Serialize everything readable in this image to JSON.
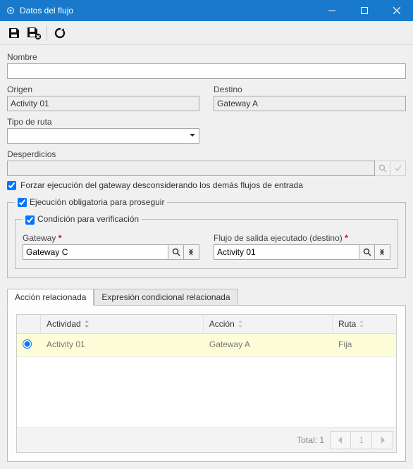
{
  "window": {
    "title": "Datos del flujo"
  },
  "toolbar": {
    "save": "Guardar",
    "save_close": "Guardar y cerrar",
    "refresh": "Actualizar"
  },
  "fields": {
    "name_label": "Nombre",
    "name_value": "",
    "origin_label": "Origen",
    "origin_value": "Activity 01",
    "dest_label": "Destino",
    "dest_value": "Gateway A",
    "route_type_label": "Tipo de ruta",
    "route_type_value": "",
    "waste_label": "Desperdicios",
    "waste_value": ""
  },
  "opts": {
    "force_label": "Forzar ejecución del gateway desconsiderando los demás flujos de entrada",
    "mandatory_legend": "Ejecución obligatoria para proseguir",
    "condition_legend": "Condición para verificación",
    "gateway_label": "Gateway",
    "gateway_value": "Gateway C",
    "outflow_label": "Flujo de salida ejecutado (destino)",
    "outflow_value": "Activity 01"
  },
  "tabs": {
    "related_action": "Acción relacionada",
    "conditional_expr": "Expresión condicional relacionada"
  },
  "grid": {
    "col_activity": "Actividad",
    "col_action": "Acción",
    "col_route": "Ruta",
    "rows": [
      {
        "activity": "Activity 01",
        "action": "Gateway A",
        "route": "Fija"
      }
    ],
    "total_label": "Total: 1",
    "page": "1"
  }
}
